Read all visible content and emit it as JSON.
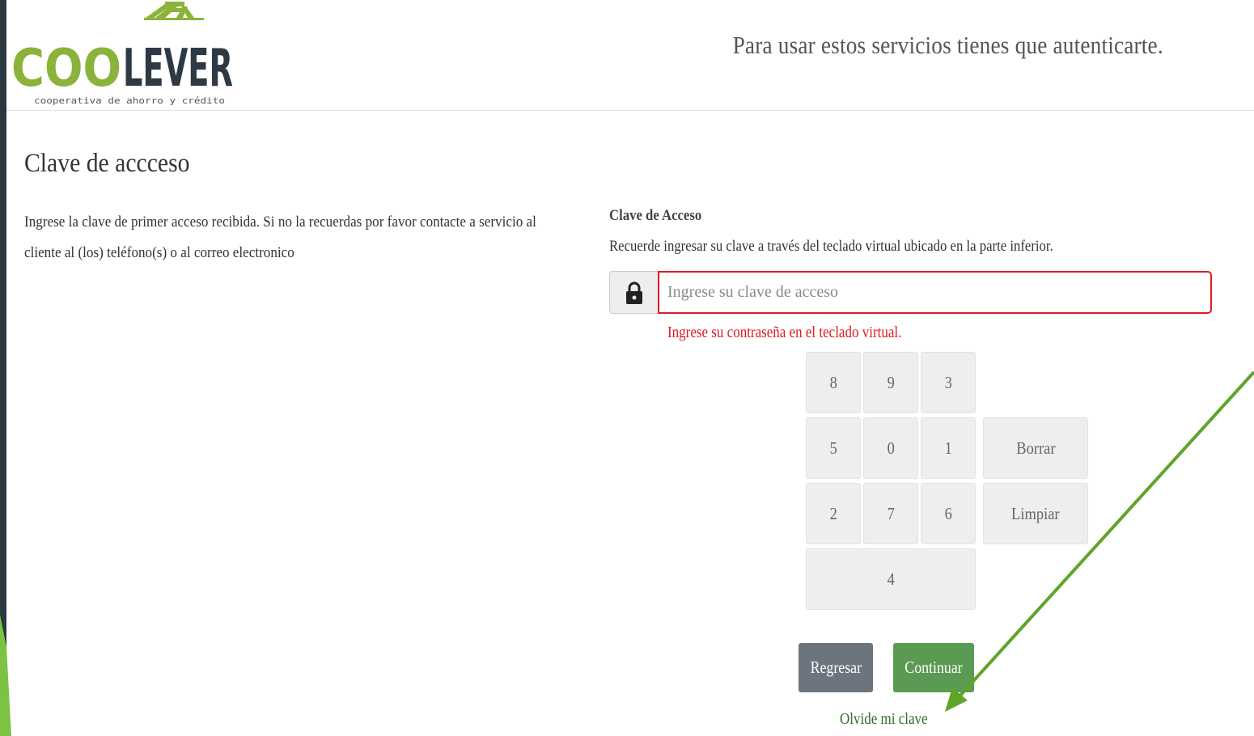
{
  "brand": {
    "logo_text": "COOLEVER",
    "logo_tagline": "cooperativa de ahorro y crédito",
    "colors": {
      "green": "#8bb33b",
      "dark": "#2d3a46"
    }
  },
  "header": {
    "message": "Para usar estos servicios tienes que autenticarte."
  },
  "main": {
    "title": "Clave de accceso",
    "intro_line1": "Ingrese la clave de primer acceso recibida. Si no la recuerdas por favor contacte a servicio al",
    "intro_line2": "cliente al (los) teléfono(s) o al correo electronico"
  },
  "form": {
    "label": "Clave de Acceso",
    "help": "Recuerde ingresar su clave a través del teclado virtual ubicado en la parte inferior.",
    "input_icon": "lock-icon",
    "placeholder": "Ingrese su clave de acceso",
    "value": "",
    "error": "Ingrese su contraseña en el teclado virtual.",
    "error_color": "#dd1c24"
  },
  "keypad": {
    "keys": [
      "8",
      "9",
      "3",
      "5",
      "0",
      "1",
      "2",
      "7",
      "6",
      "4"
    ],
    "delete_label": "Borrar",
    "clear_label": "Limpiar"
  },
  "actions": {
    "back_label": "Regresar",
    "continue_label": "Continuar",
    "forgot_label": "Olvide mi clave",
    "back_color": "#6c757d",
    "continue_color": "#5a9a53"
  },
  "annotation": {
    "arrow_color": "#5ea52a",
    "target": "forgot-password-link"
  }
}
